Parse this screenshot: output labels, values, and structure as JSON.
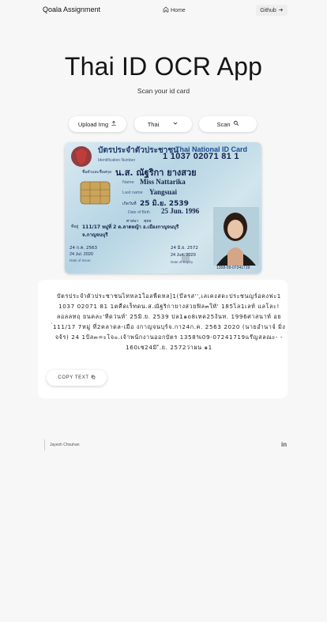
{
  "nav": {
    "brand": "Qoala Assignment",
    "home_label": "Home",
    "github_label": "Github",
    "github_icon": "arrow-right-icon",
    "home_icon": "home-icon"
  },
  "hero": {
    "title": "Thai ID OCR App",
    "subtitle": "Scan your id card"
  },
  "controls": {
    "upload_label": "Upload Img",
    "upload_icon": "upload-icon",
    "language_value": "Thai",
    "language_icon": "chevron-down-icon",
    "scan_label": "Scan",
    "scan_icon": "search-icon"
  },
  "id_card": {
    "header_thai": "บัตรประจำตัวประชาชน",
    "header_en": "Thai National ID Card",
    "id_label": "Identification Number",
    "id_number": "1 1037 02071 81 1",
    "name_thai_label": "ชื่อตัวและชื่อสกุล",
    "name_thai": "น.ส. ณัฐริกา ยางสวย",
    "name_label": "Name",
    "name_en": "Miss Nattarika",
    "last_name_label": "Last name",
    "last_name_en": "Yangsuai",
    "dob_thai_label": "เกิดวันที่",
    "dob_thai": "25 มิ.ย. 2539",
    "dob_label": "Date of Birth",
    "dob_en": "25 Jun. 1996",
    "religion_label": "ศาสนา",
    "religion": "พุทธ",
    "address_label": "ที่อยู่",
    "address_line1": "111/17 หมู่ที่ 2 ต.ลาดหญ้า อ.เมืองกาญจนบุรี",
    "address_line2": "จ.กาญจนบุรี",
    "issue_thai": "24 ก.ค. 2563",
    "issue_label": "Date of Issue",
    "issue_en": "24 Jul. 2020",
    "expiry_thai": "24 มิ.ย. 2572",
    "expiry_label": "Date of Expiry",
    "expiry_en": "24 Jun. 2029",
    "doc_number": "1358-09-07241719",
    "colors": {
      "header_blue": "#1d4b8f",
      "card_bg": "#c8e0ea"
    }
  },
  "result": {
    "text": "บัตรประจำตัวประชาชนไทหล1ใอลพืดหล]1(บ๊ลรส'',เลเคงสดะประชนญร์อคงฟะ1 1037 02071 81 1ตคืดเร็ทดน.ส.ณัฐริกายางสวยฟิล๓ใหั' 185ไล1เลท์ แลโละ!ลอลลทฤ ยนคละ'ทีดว่นท์' 25มิ.ย. 2539 ปล1๑o8เทค25ง้นท. 1996ศาสนาท์ อย ่111/17 7หมู่ ที่2คลาดล-เมือ งกาญจนบุร์จ.กา24ก.ค. 2563 2020 (นายอำนาจ์ มิ่งจจ้ร) 24 1ป้ล๓=ะโจ๐.เจ้าพน้กงานออกบัตร 1358%09-07241719แร๊ญสลณะ- - 160เช24มิ ั.ย. 2572ว่าผน ๑1",
    "copy_label": "COPY TEXT",
    "copy_icon": "copy-icon"
  },
  "footer": {
    "author": "Jayesh Chouhan",
    "linkedin_label": "in"
  }
}
